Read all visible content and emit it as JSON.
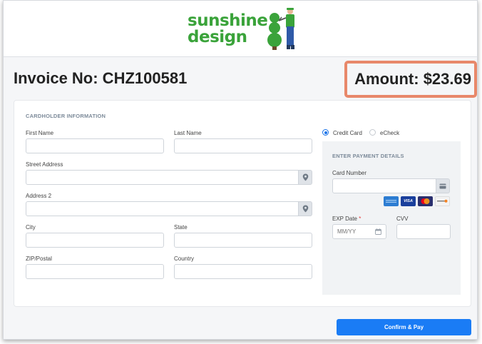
{
  "brand": {
    "logo_line1": "sunshine",
    "logo_line2": "design",
    "logo_color": "#3aa33a"
  },
  "invoice": {
    "title": "Invoice No: CHZ100581",
    "amount": "Amount: $23.69",
    "highlight_color": "#e8886a"
  },
  "cardholder": {
    "section_title": "CARDHOLDER INFORMATION",
    "first_name_label": "First Name",
    "first_name_value": "",
    "last_name_label": "Last Name",
    "last_name_value": "",
    "street_label": "Street Address",
    "street_value": "",
    "address2_label": "Address 2",
    "address2_value": "",
    "city_label": "City",
    "city_value": "",
    "state_label": "State",
    "state_value": "",
    "zip_label": "ZIP/Postal",
    "zip_value": "",
    "country_label": "Country",
    "country_value": "",
    "location_icon": "map-pin-icon"
  },
  "payment": {
    "method_credit": "Credit Card",
    "method_echeck": "eCheck",
    "selected_method": "Credit Card",
    "section_title": "ENTER PAYMENT DETAILS",
    "card_number_label": "Card Number",
    "card_number_value": "",
    "card_icon": "credit-card-icon",
    "brands": [
      "amex-icon",
      "visa-icon",
      "mastercard-icon",
      "discover-icon"
    ],
    "visa_text": "VISA",
    "exp_label": "EXP Date",
    "exp_required": "*",
    "exp_placeholder": "MM/YY",
    "cvv_label": "CVV",
    "cvv_value": ""
  },
  "actions": {
    "confirm_label": "Confirm & Pay",
    "accent_color": "#1a7cf5"
  }
}
